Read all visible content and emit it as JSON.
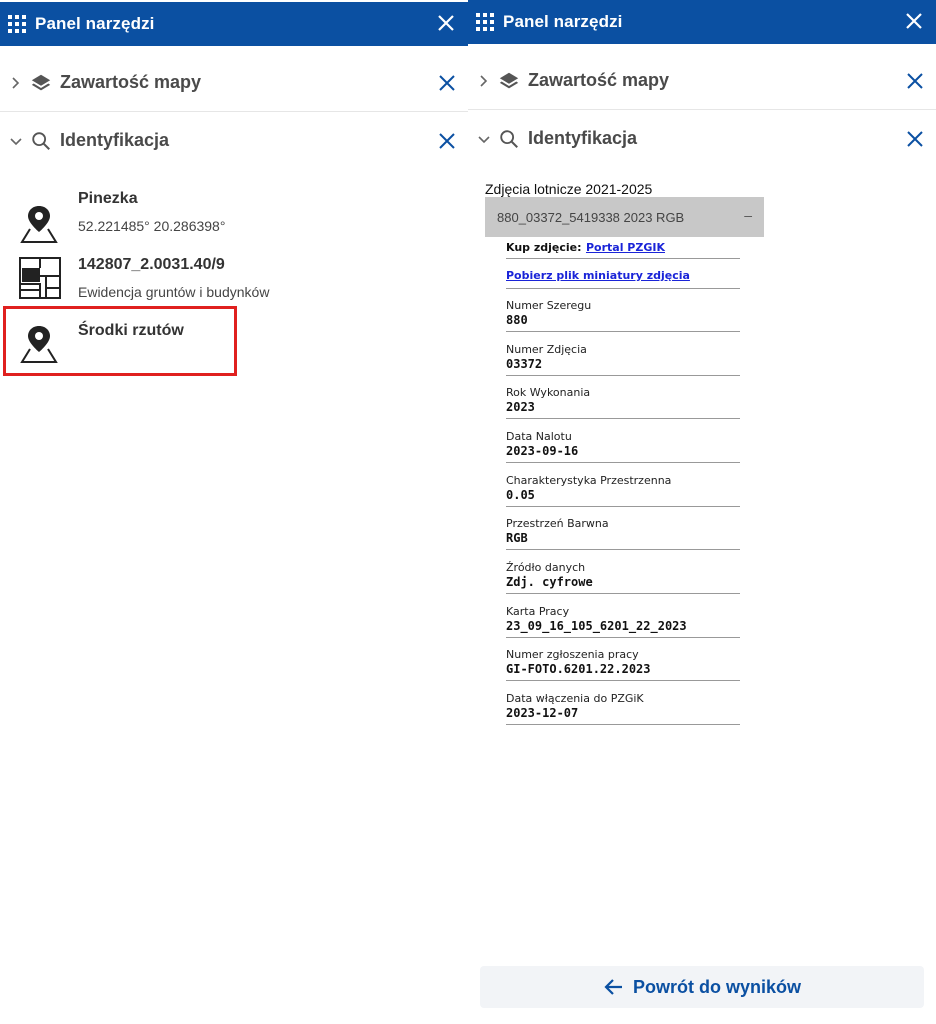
{
  "left_panel": {
    "header": {
      "title": "Panel narzędzi",
      "icon": "grid-icon",
      "close_icon": "close-icon"
    },
    "sections": [
      {
        "title": "Zawartość mapy",
        "state": "collapsed",
        "icon": "layers-icon"
      },
      {
        "title": "Identyfikacja",
        "state": "expanded",
        "icon": "search-icon"
      }
    ],
    "results": [
      {
        "title": "Pinezka",
        "subtitle": "52.221485° 20.286398°",
        "icon": "map-pin-icon"
      },
      {
        "title": "142807_2.0031.40/9",
        "subtitle": "Ewidencja gruntów i budynków",
        "icon": "parcel-map-icon"
      },
      {
        "title": "Środki rzutów",
        "subtitle": "",
        "icon": "map-pin-icon",
        "highlighted": true
      }
    ]
  },
  "right_panel": {
    "header": {
      "title": "Panel narzędzi",
      "icon": "grid-icon",
      "close_icon": "close-icon"
    },
    "sections": [
      {
        "title": "Zawartość mapy",
        "state": "collapsed",
        "icon": "layers-icon"
      },
      {
        "title": "Identyfikacja",
        "state": "expanded",
        "icon": "search-icon"
      }
    ],
    "layer_name": "Zdjęcia lotnicze 2021-2025",
    "feature": {
      "label": "880_03372_5419338 2023 RGB",
      "toggle": "–"
    },
    "buy_photo": {
      "label": "Kup zdjęcie:",
      "link": "Portal PZGIK"
    },
    "download_link": "Pobierz plik miniatury zdjęcia",
    "attributes": [
      {
        "label": "Numer Szeregu",
        "value": "880"
      },
      {
        "label": "Numer Zdjęcia",
        "value": "03372"
      },
      {
        "label": "Rok Wykonania",
        "value": "2023"
      },
      {
        "label": "Data Nalotu",
        "value": "2023-09-16"
      },
      {
        "label": "Charakterystyka Przestrzenna",
        "value": "0.05"
      },
      {
        "label": "Przestrzeń Barwna",
        "value": "RGB"
      },
      {
        "label": "Źródło danych",
        "value": "Zdj. cyfrowe"
      },
      {
        "label": "Karta Pracy",
        "value": "23_09_16_105_6201_22_2023"
      },
      {
        "label": "Numer zgłoszenia pracy",
        "value": "GI-FOTO.6201.22.2023"
      },
      {
        "label": "Data włączenia do PZGiK",
        "value": "2023-12-07"
      }
    ],
    "back_button": {
      "label": "Powrót do wyników",
      "icon": "arrow-left-icon"
    }
  },
  "colors": {
    "header_bg": "#0b50a2",
    "accent": "#0b50a2",
    "highlight_border": "#e0201f",
    "link": "#1a24d8"
  }
}
